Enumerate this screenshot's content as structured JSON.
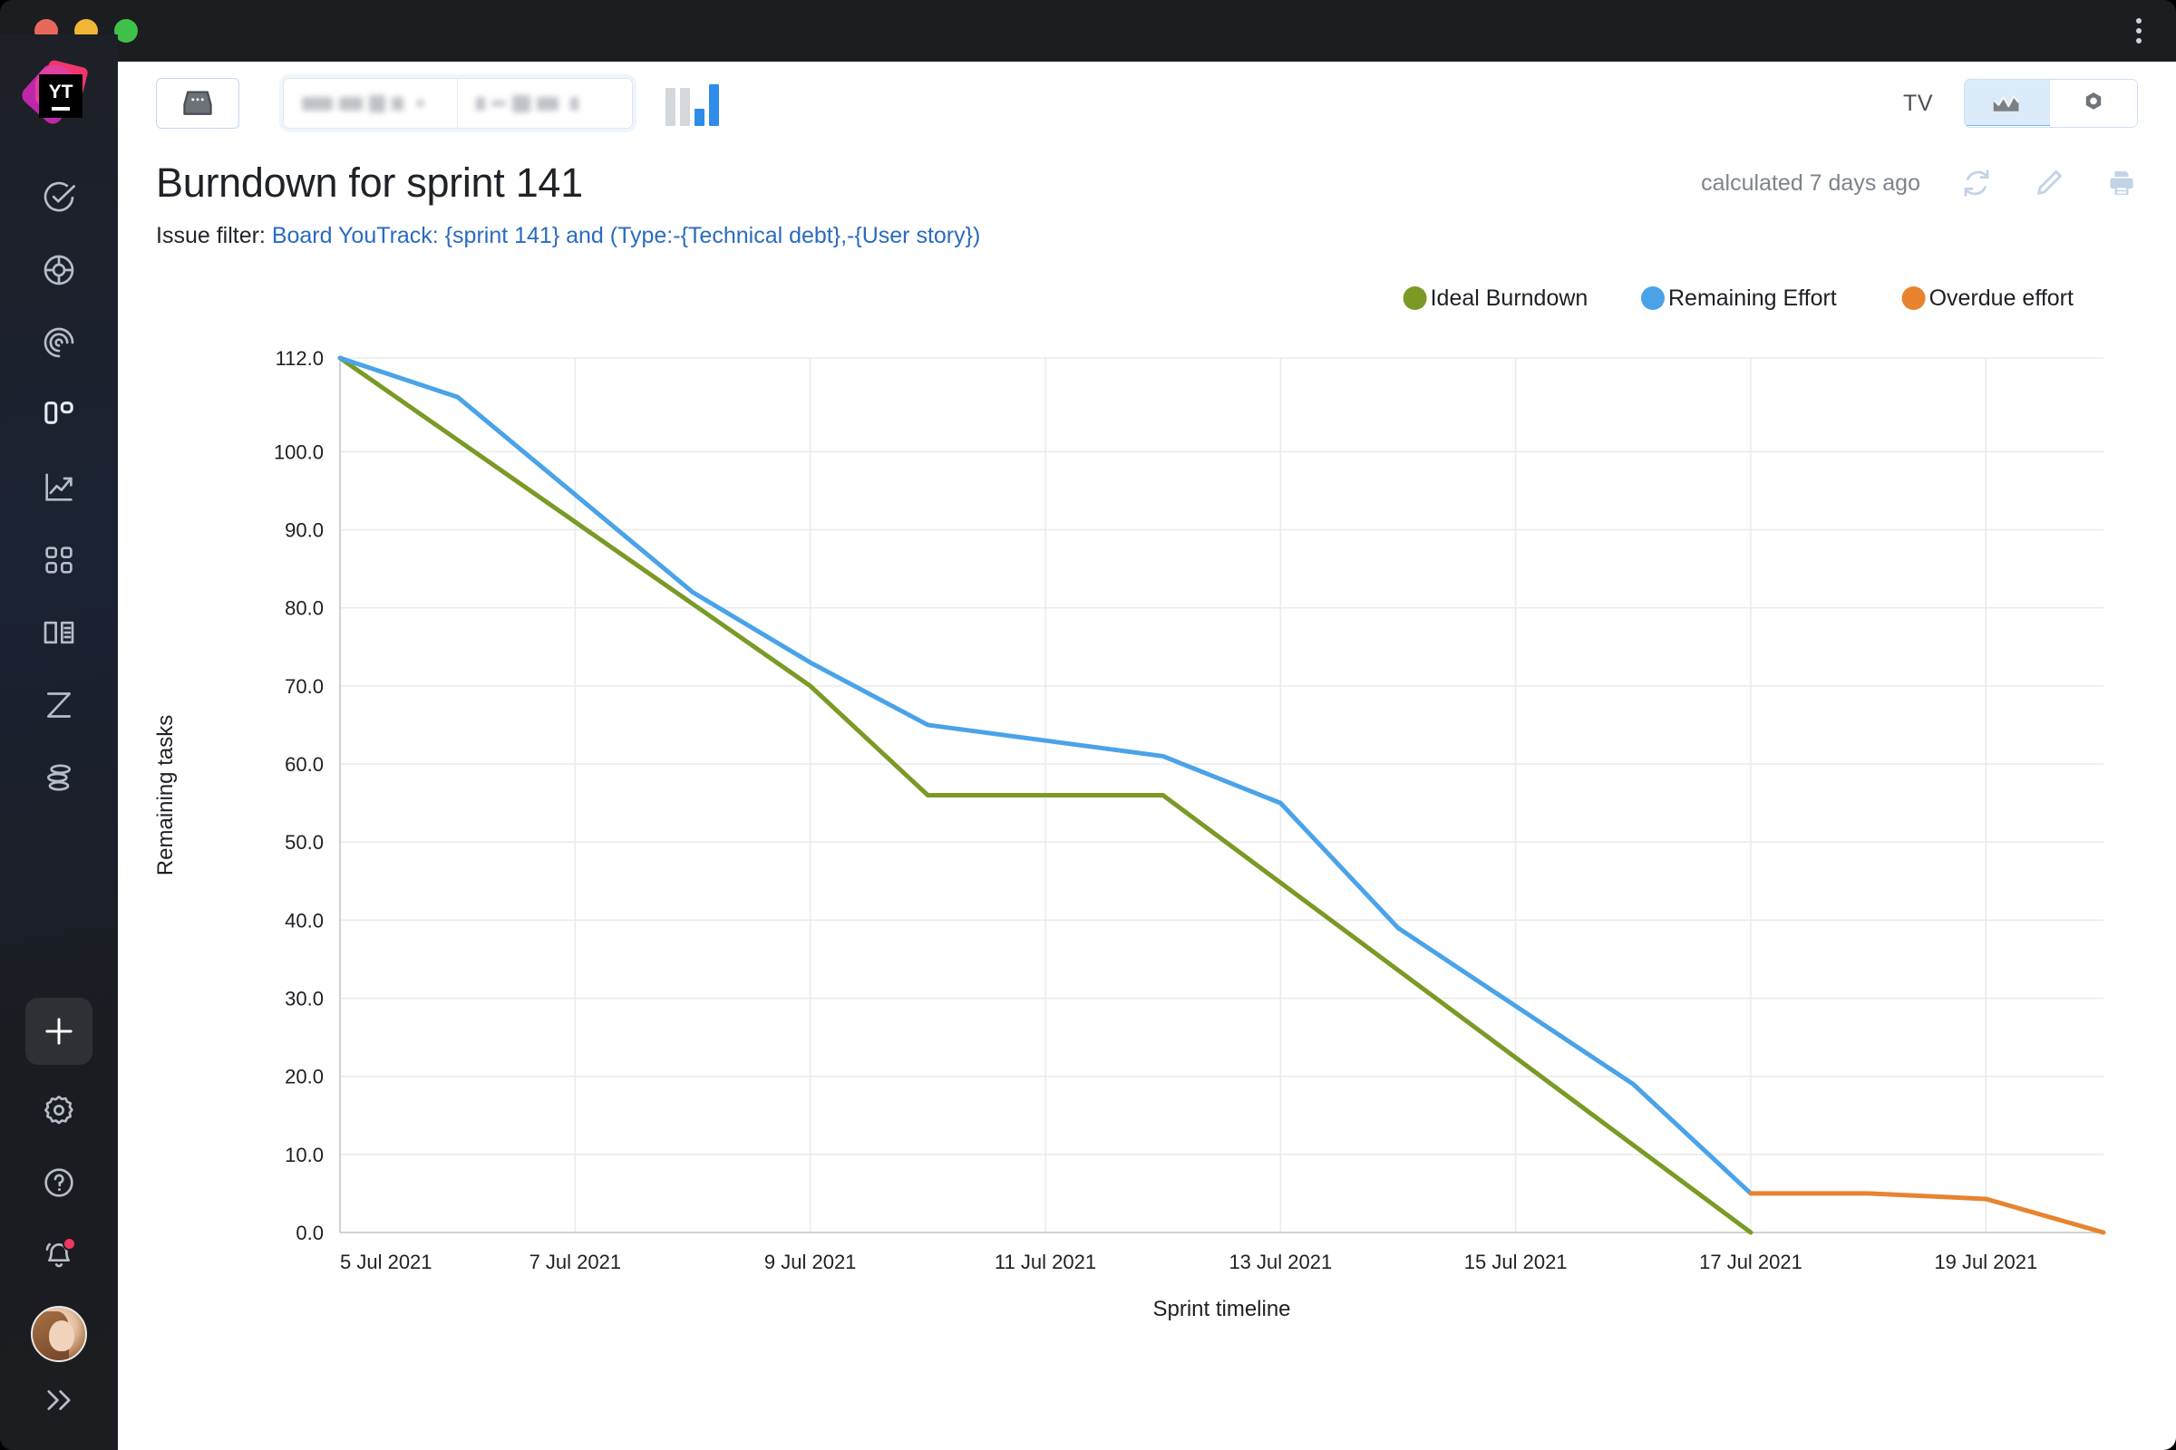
{
  "window": {
    "traffic_lights": [
      "close",
      "minimize",
      "zoom"
    ],
    "menu_icon": "kebab-menu-icon"
  },
  "sidebar": {
    "logo_text": "YT",
    "items": [
      {
        "name": "issues",
        "icon": "check-circle-icon"
      },
      {
        "name": "agile-boards",
        "icon": "agile-board-icon"
      },
      {
        "name": "helpdesk",
        "icon": "helpdesk-icon"
      },
      {
        "name": "dashboards",
        "icon": "dashboard-icon"
      },
      {
        "name": "reports",
        "icon": "report-trend-icon"
      },
      {
        "name": "projects",
        "icon": "grid-apps-icon"
      },
      {
        "name": "knowledge-base",
        "icon": "book-icon"
      },
      {
        "name": "timesheets",
        "icon": "hourglass-icon"
      },
      {
        "name": "workflows",
        "icon": "layers-icon"
      }
    ],
    "create_label": "+",
    "bottom_items": [
      {
        "name": "settings",
        "icon": "gear-icon"
      },
      {
        "name": "help",
        "icon": "question-circle-icon"
      },
      {
        "name": "notifications",
        "icon": "bell-icon",
        "badge": true
      }
    ],
    "expand_label": "»"
  },
  "toolbar": {
    "inbox_icon": "inbox-icon",
    "project_selector_redacted": true,
    "board_selector_redacted": true,
    "mini_chart_icon": "bar-chart-icon",
    "tv_label": "TV",
    "view_chart_icon": "line-chart-icon",
    "view_settings_icon": "gear-icon",
    "active_view": "chart"
  },
  "header": {
    "title": "Burndown for sprint 141",
    "filter_prefix": "Issue filter:",
    "filter_query": "Board YouTrack: {sprint 141} and (Type:-{Technical debt},-{User story})",
    "calculated_text": "calculated 7 days ago",
    "refresh_icon": "refresh-icon",
    "edit_icon": "pencil-icon",
    "print_icon": "printer-icon"
  },
  "chart_data": {
    "type": "line",
    "title": "Burndown for sprint 141",
    "xlabel": "Sprint timeline",
    "ylabel": "Remaining tasks",
    "grid": true,
    "legend_position": "top-right",
    "xlim": [
      "2021-07-05",
      "2021-07-20"
    ],
    "ylim": [
      0,
      112
    ],
    "yticks": [
      0,
      10,
      20,
      30,
      40,
      50,
      60,
      70,
      80,
      90,
      100,
      112
    ],
    "ytick_labels": [
      "0.0",
      "10.0",
      "20.0",
      "30.0",
      "40.0",
      "50.0",
      "60.0",
      "70.0",
      "80.0",
      "90.0",
      "100.0",
      "112.0"
    ],
    "xticks": [
      "2021-07-05",
      "2021-07-07",
      "2021-07-09",
      "2021-07-11",
      "2021-07-13",
      "2021-07-15",
      "2021-07-17",
      "2021-07-19"
    ],
    "xtick_labels": [
      "5 Jul 2021",
      "7 Jul 2021",
      "9 Jul 2021",
      "11 Jul 2021",
      "13 Jul 2021",
      "15 Jul 2021",
      "17 Jul 2021",
      "19 Jul 2021"
    ],
    "colors": {
      "ideal": "#7a9a25",
      "remaining": "#4aa3e8",
      "overdue": "#e8832f"
    },
    "series": [
      {
        "name": "Ideal Burndown",
        "color": "#7a9a25",
        "x": [
          "2021-07-05",
          "2021-07-09",
          "2021-07-10",
          "2021-07-12",
          "2021-07-17"
        ],
        "values": [
          112,
          70,
          56,
          56,
          0
        ]
      },
      {
        "name": "Remaining Effort",
        "color": "#4aa3e8",
        "x": [
          "2021-07-05",
          "2021-07-06",
          "2021-07-08",
          "2021-07-09",
          "2021-07-10",
          "2021-07-11",
          "2021-07-12",
          "2021-07-13",
          "2021-07-14",
          "2021-07-16",
          "2021-07-17"
        ],
        "values": [
          112,
          107,
          82,
          73,
          65,
          63,
          61,
          55,
          39,
          19,
          5
        ]
      },
      {
        "name": "Overdue effort",
        "color": "#e8832f",
        "x": [
          "2021-07-17",
          "2021-07-18",
          "2021-07-19",
          "2021-07-20"
        ],
        "values": [
          5,
          5,
          4.3,
          0
        ]
      }
    ]
  }
}
